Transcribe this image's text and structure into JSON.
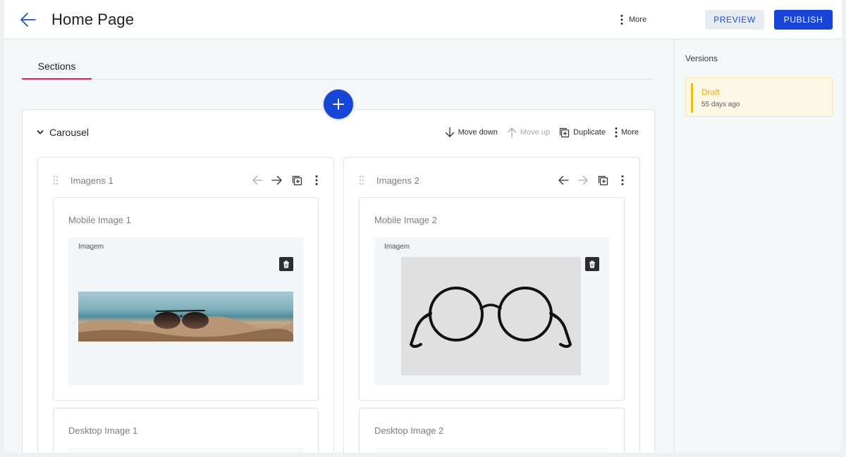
{
  "header": {
    "title": "Home Page",
    "more_label": "More",
    "preview_label": "PREVIEW",
    "publish_label": "PUBLISH"
  },
  "tabs": [
    {
      "label": "Sections",
      "active": true
    }
  ],
  "section": {
    "title": "Carousel",
    "actions": {
      "move_down": "Move down",
      "move_up": "Move up",
      "duplicate": "Duplicate",
      "more": "More"
    }
  },
  "items": [
    {
      "title": "Imagens 1",
      "mobile_label": "Mobile Image 1",
      "image_caption": "Imagem",
      "image_icon": "sunglasses-on-sand",
      "desktop_label": "Desktop Image 1"
    },
    {
      "title": "Imagens 2",
      "mobile_label": "Mobile Image 2",
      "image_caption": "Imagem",
      "image_icon": "round-eyeglasses",
      "desktop_label": "Desktop Image 2"
    }
  ],
  "versions": {
    "title": "Versions",
    "entries": [
      {
        "status": "Draft",
        "time": "55 days ago"
      }
    ]
  },
  "colors": {
    "primary": "#1845d6",
    "tab_accent": "#e01e6a",
    "draft_accent": "#f5b719"
  }
}
